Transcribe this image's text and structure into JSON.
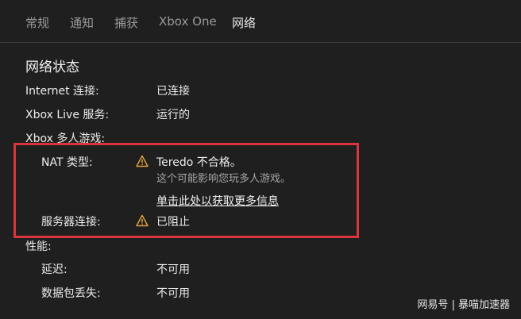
{
  "tabs": [
    {
      "label": "常规"
    },
    {
      "label": "通知"
    },
    {
      "label": "捕获"
    },
    {
      "label": "Xbox One"
    },
    {
      "label": "网络"
    }
  ],
  "section_title": "网络状态",
  "rows": {
    "internet": {
      "label": "Internet 连接:",
      "value": "已连接"
    },
    "xbox_live": {
      "label": "Xbox Live 服务:",
      "value": "运行的"
    },
    "multiplayer": {
      "label": "Xbox 多人游戏:"
    },
    "nat": {
      "label": "NAT 类型:",
      "value": "Teredo 不合格。",
      "sub": "这个可能影响您玩多人游戏。",
      "link": "单击此处以获取更多信息"
    },
    "server": {
      "label": "服务器连接:",
      "value": "已阻止"
    },
    "performance": {
      "label": "性能:"
    },
    "latency": {
      "label": "延迟:",
      "value": "不可用"
    },
    "packet_loss": {
      "label": "数据包丢失:",
      "value": "不可用"
    }
  },
  "warning_color": "#e8a63b",
  "highlight_color": "#d8353e",
  "watermark": "网易号 | 暴喵加速器"
}
